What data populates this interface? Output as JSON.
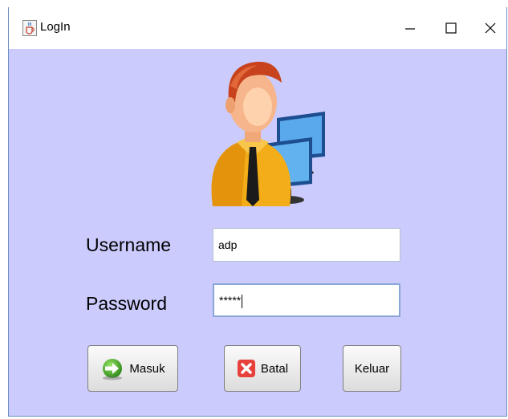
{
  "window": {
    "title": "LogIn",
    "controls": {
      "minimize": "–",
      "maximize": "□",
      "close": "X"
    }
  },
  "form": {
    "username_label": "Username",
    "username_value": "adp",
    "password_label": "Password",
    "password_value": "*****"
  },
  "buttons": {
    "masuk": "Masuk",
    "batal": "Batal",
    "keluar": "Keluar"
  },
  "icons": {
    "app": "java-cup-icon",
    "avatar": "user-computer-icon",
    "masuk": "login-arrow-icon",
    "batal": "cancel-x-icon"
  },
  "colors": {
    "background": "#cbcbfd",
    "titlebar": "#ffffff"
  }
}
